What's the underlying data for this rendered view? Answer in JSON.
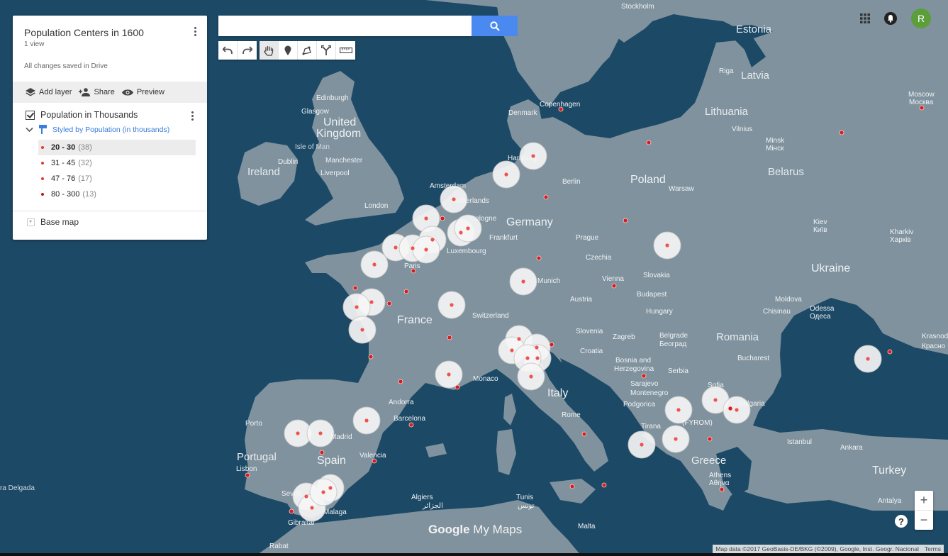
{
  "panel": {
    "title": "Population Centers in 1600",
    "views": "1 view",
    "saved": "All changes saved in Drive",
    "actions": {
      "add_layer": "Add layer",
      "share": "Share",
      "preview": "Preview"
    },
    "layer": {
      "name": "Population in Thousands",
      "style": "Styled by Population (in thousands)",
      "legend": [
        {
          "range": "20 - 30",
          "count": "(38)"
        },
        {
          "range": "31 - 45",
          "count": "(32)"
        },
        {
          "range": "47 - 76",
          "count": "(17)"
        },
        {
          "range": "80 - 300",
          "count": "(13)"
        }
      ]
    },
    "base_map": "Base map"
  },
  "search": {
    "value": "",
    "placeholder": ""
  },
  "user": {
    "initial": "R"
  },
  "map_labels": {
    "stockholm": "Stockholm",
    "estonia": "Estonia",
    "riga": "Riga",
    "latvia": "Latvia",
    "edinburgh": "Edinburgh",
    "glasgow": "Glasgow",
    "united": "United",
    "kingdom": "Kingdom",
    "denmark": "Denmark",
    "copenhagen": "Copenhagen",
    "lithuania": "Lithuania",
    "vilnius": "Vilnius",
    "moscow": "Moscow",
    "moscow_cy": "Москва",
    "minsk": "Minsk",
    "minsk_cy": "Мінск",
    "isle_of_man": "Isle of Man",
    "dublin": "Dublin",
    "ireland": "Ireland",
    "manchester": "Manchester",
    "liverpool": "Liverpool",
    "hamburg": "Hamburg",
    "berlin": "Berlin",
    "poland": "Poland",
    "warsaw": "Warsaw",
    "belarus": "Belarus",
    "amsterdam": "Amsterdam",
    "netherlands": "Netherlands",
    "london": "London",
    "cologne": "Cologne",
    "germany": "Germany",
    "frankfurt": "Frankfurt",
    "prague": "Prague",
    "czechia": "Czechia",
    "luxembourg": "Luxembourg",
    "kiev": "Kiev",
    "kiev_cy": "Київ",
    "kharkiv": "Kharkiv",
    "kharkiv_cy": "Харків",
    "paris": "Paris",
    "munich": "Munich",
    "vienna": "Vienna",
    "slovakia": "Slovakia",
    "ukraine": "Ukraine",
    "austria": "Austria",
    "budapest": "Budapest",
    "hungary": "Hungary",
    "moldova": "Moldova",
    "chisinau": "Chisinau",
    "odessa": "Odessa",
    "odessa_cy": "Одеса",
    "france": "France",
    "switzerland": "Switzerland",
    "slovenia": "Slovenia",
    "zagreb": "Zagreb",
    "romania": "Romania",
    "belgrade": "Belgrade",
    "belgrade_cy": "Београд",
    "croatia": "Croatia",
    "bucharest": "Bucharest",
    "krasnodar": "Krasnod",
    "krasnodar_cy": "Красно",
    "bosnia": "Bosnia and",
    "herzegovina": "Herzegovina",
    "serbia": "Serbia",
    "monaco": "Monaco",
    "italy": "Italy",
    "sarajevo": "Sarajevo",
    "montenegro": "Montenegro",
    "sofia": "Sofia",
    "andorra": "Andorra",
    "podgorica": "Podgorica",
    "rome": "Rome",
    "bulgaria": "Bulgaria",
    "porto": "Porto",
    "barcelona": "Barcelona",
    "madrid": "Madrid",
    "tirana": "Tirana",
    "fyrom": "(FYROM)",
    "istanbul": "Istanbul",
    "portugal": "Portugal",
    "spain": "Spain",
    "valencia": "Valencia",
    "ankara": "Ankara",
    "greece": "Greece",
    "lisbon": "Lisbon",
    "turkey": "Turkey",
    "athens": "Athens",
    "athens_gr": "Αθήνα",
    "madeira": "ra Delgada",
    "seville": "Seville",
    "malaga": "Malaga",
    "gibraltar": "Gibraltar",
    "algiers": "Algiers",
    "algiers_ar": "الجزائر",
    "tunis": "Tunis",
    "tunis_ar": "تونس",
    "antalya": "Antalya",
    "malta": "Malta",
    "rabat": "Rabat"
  },
  "brand": {
    "google": "Google",
    "mymaps": "My Maps"
  },
  "attribution": {
    "text": "Map data ©2017 GeoBasis-DE/BKG (©2009), Google, Inst. Geogr. Nacional",
    "terms": "Terms"
  },
  "colors": {
    "dot": "#d81b1b",
    "halo": "#f5f5f5",
    "land": "#7f929e",
    "sea": "#1c4966",
    "accent": "#4a89f0",
    "avatar": "#5c9e3a"
  },
  "icons": [
    "more-vert-icon",
    "layers-icon",
    "add-person-icon",
    "eye-icon",
    "checkbox-icon",
    "chevron-down-icon",
    "paint-roller-icon",
    "search-icon",
    "undo-icon",
    "redo-icon",
    "hand-icon",
    "marker-icon",
    "polyline-icon",
    "route-icon",
    "ruler-icon",
    "apps-grid-icon",
    "bell-icon"
  ],
  "map_points": {
    "small": [
      [
        791,
        154
      ],
      [
        915,
        201
      ],
      [
        1187,
        187
      ],
      [
        1300,
        152
      ],
      [
        770,
        278
      ],
      [
        882,
        311
      ],
      [
        760,
        364
      ],
      [
        573,
        411
      ],
      [
        549,
        428
      ],
      [
        501,
        406
      ],
      [
        634,
        476
      ],
      [
        523,
        503
      ],
      [
        565,
        538
      ],
      [
        645,
        546
      ],
      [
        778,
        486
      ],
      [
        824,
        612
      ],
      [
        852,
        684
      ],
      [
        807,
        686
      ],
      [
        1001,
        619
      ],
      [
        1018,
        690
      ],
      [
        908,
        530
      ],
      [
        1255,
        496
      ],
      [
        866,
        403
      ],
      [
        580,
        599
      ],
      [
        1030,
        576
      ],
      [
        528,
        650
      ],
      [
        454,
        638
      ],
      [
        349,
        670
      ],
      [
        411,
        721
      ],
      [
        583,
        382
      ],
      [
        624,
        308
      ]
    ],
    "halos": [
      [
        752,
        220
      ],
      [
        714,
        246
      ],
      [
        640,
        281
      ],
      [
        601,
        308
      ],
      [
        650,
        328
      ],
      [
        660,
        322
      ],
      [
        610,
        338
      ],
      [
        558,
        349
      ],
      [
        582,
        350
      ],
      [
        601,
        352
      ],
      [
        528,
        373
      ],
      [
        738,
        397
      ],
      [
        941,
        346
      ],
      [
        637,
        430
      ],
      [
        524,
        426
      ],
      [
        503,
        433
      ],
      [
        511,
        465
      ],
      [
        732,
        478
      ],
      [
        722,
        494
      ],
      [
        757,
        490
      ],
      [
        758,
        505
      ],
      [
        744,
        505
      ],
      [
        749,
        531
      ],
      [
        633,
        528
      ],
      [
        517,
        593
      ],
      [
        420,
        611
      ],
      [
        452,
        611
      ],
      [
        957,
        578
      ],
      [
        1009,
        564
      ],
      [
        1039,
        578
      ],
      [
        953,
        619
      ],
      [
        905,
        627
      ],
      [
        432,
        700
      ],
      [
        440,
        716
      ],
      [
        466,
        688
      ],
      [
        456,
        694
      ],
      [
        1224,
        506
      ]
    ]
  }
}
